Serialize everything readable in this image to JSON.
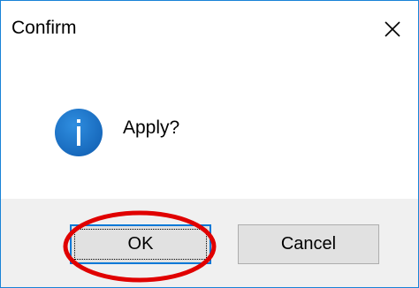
{
  "dialog": {
    "title": "Confirm",
    "close_icon": "close-icon",
    "message": "Apply?",
    "message_icon": "info-icon",
    "buttons": {
      "ok_label": "OK",
      "cancel_label": "Cancel"
    }
  },
  "colors": {
    "accent": "#0078d7",
    "window_border": "#1883d7",
    "info_icon": "#1a73c9",
    "footer_bg": "#f0f0f0",
    "button_bg": "#e1e1e1",
    "annotation": "#e00000"
  },
  "annotation": {
    "shape": "ellipse",
    "target": "ok-button"
  }
}
